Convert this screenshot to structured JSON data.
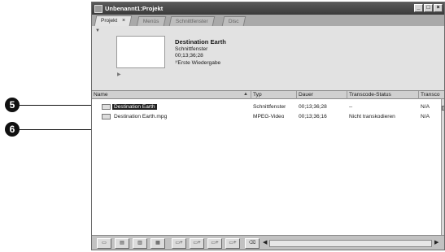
{
  "callouts": {
    "c5": "5",
    "c6": "6"
  },
  "window": {
    "title": "Unbenannt1:Projekt",
    "controls": {
      "minimize": "_",
      "maximize": "□",
      "close": "×"
    }
  },
  "tabs": [
    {
      "label": "Projekt",
      "close": "×"
    },
    {
      "label": "Menüs"
    },
    {
      "label": "Schnittfenster"
    },
    {
      "label": "Disc"
    }
  ],
  "preview": {
    "title": "Destination Earth",
    "type": "Schnittfenster",
    "duration": "00;13;36;28",
    "extra": "¹′Erste Wiedergabe"
  },
  "columns": {
    "name": "Name",
    "typ": "Typ",
    "dauer": "Dauer",
    "transcode_status": "Transcode-Status",
    "transcode": "Transco"
  },
  "rows": [
    {
      "name": "Destination Earth",
      "typ": "Schnittfenster",
      "dauer": "00;13;36;28",
      "status": "--",
      "transcode": "N/A",
      "selected": true
    },
    {
      "name": "Destination Earth.mpg",
      "typ": "MPEG-Video",
      "dauer": "00;13;36;16",
      "status": "Nicht transkodieren",
      "transcode": "N/A",
      "selected": false
    }
  ],
  "icons": {
    "app": "app-icon",
    "collapse": "chevron-down-icon",
    "play": "play-icon",
    "sort": "sort-up-icon",
    "timeline": "timeline-icon",
    "video": "video-file-icon"
  },
  "colors": {
    "titlebar": "#3a3a3a",
    "selection": "#222222",
    "panel": "#e2e2e2"
  }
}
